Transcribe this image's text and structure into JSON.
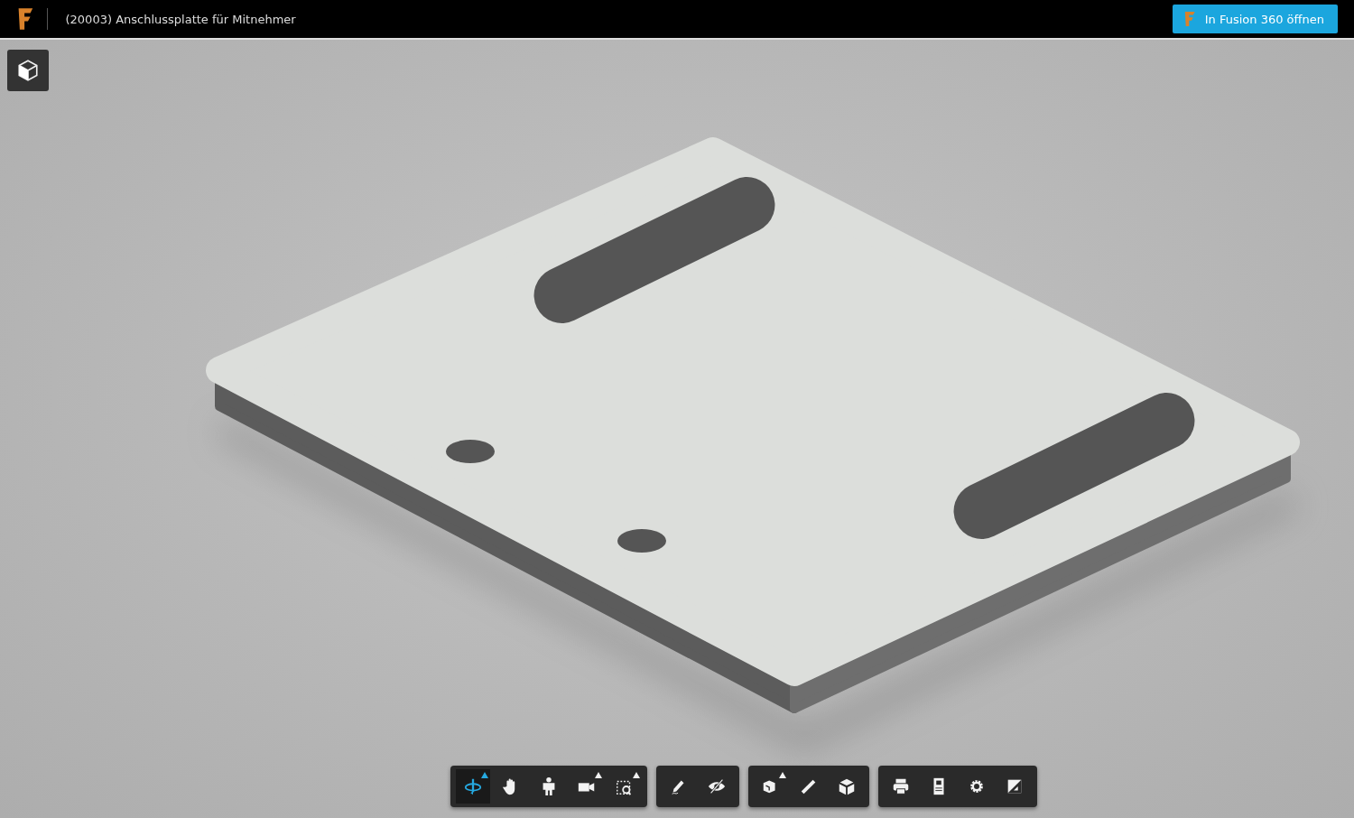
{
  "header": {
    "title": "(20003) Anschlussplatte für Mitnehmer",
    "open_button": "In Fusion 360 öffnen"
  },
  "toolbar": [
    [
      {
        "kind": "orbit",
        "selected": true,
        "menu": true
      },
      {
        "kind": "pan",
        "selected": false,
        "menu": false
      },
      {
        "kind": "walk",
        "selected": false,
        "menu": false
      },
      {
        "kind": "camera",
        "selected": false,
        "menu": true
      },
      {
        "kind": "zoom-window",
        "selected": false,
        "menu": true
      }
    ],
    [
      {
        "kind": "markup",
        "selected": false,
        "menu": false
      },
      {
        "kind": "hide",
        "selected": false,
        "menu": false
      }
    ],
    [
      {
        "kind": "explode",
        "selected": false,
        "menu": true
      },
      {
        "kind": "measure",
        "selected": false,
        "menu": false
      },
      {
        "kind": "parts",
        "selected": false,
        "menu": false
      }
    ],
    [
      {
        "kind": "print",
        "selected": false,
        "menu": false
      },
      {
        "kind": "properties",
        "selected": false,
        "menu": false
      },
      {
        "kind": "settings",
        "selected": false,
        "menu": false
      },
      {
        "kind": "fullscreen",
        "selected": false,
        "menu": false
      }
    ]
  ]
}
